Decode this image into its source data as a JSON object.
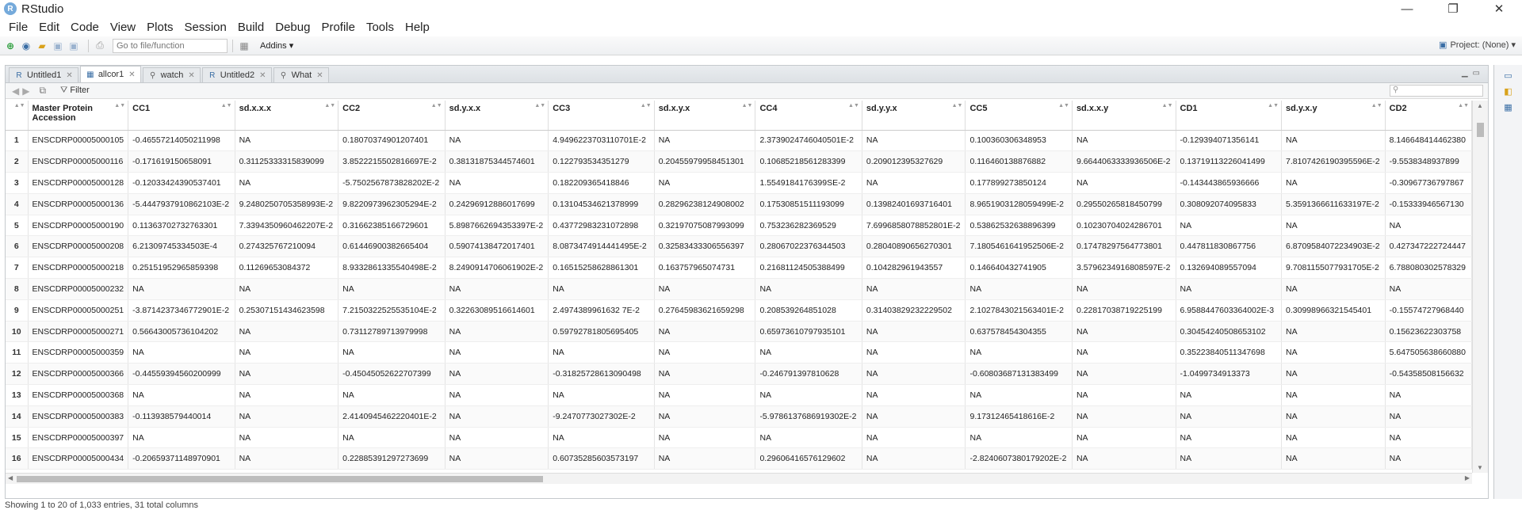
{
  "window": {
    "title": "RStudio",
    "logo_letter": "R",
    "minimize": "—",
    "maximize": "❐",
    "close": "✕"
  },
  "menu": [
    "File",
    "Edit",
    "Code",
    "View",
    "Plots",
    "Session",
    "Build",
    "Debug",
    "Profile",
    "Tools",
    "Help"
  ],
  "toolbar": {
    "goto_placeholder": "Go to file/function",
    "addins_label": "Addins ▾",
    "project_label": "Project: (None) ▾"
  },
  "tabs": [
    {
      "label": "Untitled1",
      "icon": "R"
    },
    {
      "label": "allcor1",
      "icon": "▦"
    },
    {
      "label": "watch",
      "icon": "🔍"
    },
    {
      "label": "Untitled2",
      "icon": "R"
    },
    {
      "label": "What",
      "icon": "🔍"
    }
  ],
  "filter_label": "Filter",
  "table": {
    "columns": [
      "",
      "Master Protein Accession",
      "CC1",
      "sd.x.x.x",
      "CC2",
      "sd.y.x.x",
      "CC3",
      "sd.x.y.x",
      "CC4",
      "sd.y.y.x",
      "CC5",
      "sd.x.x.y",
      "CD1",
      "sd.y.x.y",
      "CD2"
    ],
    "rows": [
      [
        "1",
        "ENSCDRP00005000105",
        "-0.46557214050211998",
        "NA",
        "0.18070374901207401",
        "NA",
        "4.9496223703110701E-2",
        "NA",
        "2.3739024746040501E-2",
        "NA",
        "0.100360306348953",
        "NA",
        "-0.129394071356141",
        "NA",
        "8.146648414462380"
      ],
      [
        "2",
        "ENSCDRP00005000116",
        "-0.171619150658091",
        "0.31125333315839099",
        "3.8522215502816697E-2",
        "0.38131875344574601",
        "0.122793534351279",
        "0.20455979958451301",
        "0.10685218561283399",
        "0.209012395327629",
        "0.116460138876882",
        "9.6644063333936506E-2",
        "0.13719113226041499",
        "7.8107426190395596E-2",
        "-9.5538348937899"
      ],
      [
        "3",
        "ENSCDRP00005000128",
        "-0.12033424390537401",
        "NA",
        "-5.7502567873828202E-2",
        "NA",
        "0.182209365418846",
        "NA",
        "1.5549184176399SE-2",
        "NA",
        "0.177899273850124",
        "NA",
        "-0.143443865936666",
        "NA",
        "-0.30967736797867"
      ],
      [
        "4",
        "ENSCDRP00005000136",
        "-5.4447937910862103E-2",
        "9.2480250705358993E-2",
        "9.8220973962305294E-2",
        "0.24296912886017699",
        "0.13104534621378999",
        "0.28296238124908002",
        "0.17530851511193099",
        "0.13982401693716401",
        "8.9651903128059499E-2",
        "0.29550265818450799",
        "0.308092074095833",
        "5.3591366611633197E-2",
        "-0.15333946567130"
      ],
      [
        "5",
        "ENSCDRP00005000190",
        "0.11363702732763301",
        "7.3394350960462207E-2",
        "0.31662385166729601",
        "5.8987662694353397E-2",
        "0.43772983231072898",
        "0.32197075087993099",
        "0.753236282369529",
        "7.6996858078852801E-2",
        "0.53862532638896399",
        "0.10230704024286701",
        "NA",
        "NA",
        "NA"
      ],
      [
        "6",
        "ENSCDRP00005000208",
        "6.21309745334503E-4",
        "0.274325767210094",
        "0.61446900382665404",
        "0.59074138472017401",
        "8.0873474914441495E-2",
        "0.32583433306556397",
        "0.28067022376344503",
        "0.28040890656270301",
        "7.1805461641952506E-2",
        "0.17478297564773801",
        "0.447811830867756",
        "6.8709584072234903E-2",
        "0.427347222724447"
      ],
      [
        "7",
        "ENSCDRP00005000218",
        "0.25151952965859398",
        "0.11269653084372",
        "8.9332861335540498E-2",
        "8.2490914706061902E-2",
        "0.16515258628861301",
        "0.163757965074731",
        "0.21681124505388499",
        "0.104282961943557",
        "0.146640432741905",
        "3.5796234916808597E-2",
        "0.132694089557094",
        "9.7081155077931705E-2",
        "6.788080302578329"
      ],
      [
        "8",
        "ENSCDRP00005000232",
        "NA",
        "NA",
        "NA",
        "NA",
        "NA",
        "NA",
        "NA",
        "NA",
        "NA",
        "NA",
        "NA",
        "NA",
        "NA"
      ],
      [
        "9",
        "ENSCDRP00005000251",
        "-3.8714237346772901E-2",
        "0.25307151434623598",
        "7.2150322525535104E-2",
        "0.32263089516614601",
        "2.4974389961632 7E-2",
        "0.27645983621659298",
        "0.208539264851028",
        "0.31403829232229502",
        "2.1027843021563401E-2",
        "0.22817038719225199",
        "6.9588447603364002E-3",
        "0.30998966321545401",
        "-0.15574727968440"
      ],
      [
        "10",
        "ENSCDRP00005000271",
        "0.56643005736104202",
        "NA",
        "0.73112789713979998",
        "NA",
        "0.59792781805695405",
        "NA",
        "0.65973610797935101",
        "NA",
        "0.637578454304355",
        "NA",
        "0.30454240508653102",
        "NA",
        "0.15623622303758"
      ],
      [
        "11",
        "ENSCDRP00005000359",
        "NA",
        "NA",
        "NA",
        "NA",
        "NA",
        "NA",
        "NA",
        "NA",
        "NA",
        "NA",
        "0.35223840511347698",
        "NA",
        "5.647505638660880"
      ],
      [
        "12",
        "ENSCDRP00005000366",
        "-0.44559394560200999",
        "NA",
        "-0.45045052622707399",
        "NA",
        "-0.31825728613090498",
        "NA",
        "-0.246791397810628",
        "NA",
        "-0.60803687131383499",
        "NA",
        "-1.0499734913373",
        "NA",
        "-0.54358508156632"
      ],
      [
        "13",
        "ENSCDRP00005000368",
        "NA",
        "NA",
        "NA",
        "NA",
        "NA",
        "NA",
        "NA",
        "NA",
        "NA",
        "NA",
        "NA",
        "NA",
        "NA"
      ],
      [
        "14",
        "ENSCDRP00005000383",
        "-0.113938579440014",
        "NA",
        "2.4140945462220401E-2",
        "NA",
        "-9.2470773027302E-2",
        "NA",
        "-5.9786137686919302E-2",
        "NA",
        "9.17312465418616E-2",
        "NA",
        "NA",
        "NA",
        "NA"
      ],
      [
        "15",
        "ENSCDRP00005000397",
        "NA",
        "NA",
        "NA",
        "NA",
        "NA",
        "NA",
        "NA",
        "NA",
        "NA",
        "NA",
        "NA",
        "NA",
        "NA"
      ],
      [
        "16",
        "ENSCDRP00005000434",
        "-0.20659371148970901",
        "NA",
        "0.22885391297273699",
        "NA",
        "0.60735285603573197",
        "NA",
        "0.29606416576129602",
        "NA",
        "-2.8240607380179202E-2",
        "NA",
        "NA",
        "NA",
        "NA"
      ]
    ]
  },
  "status": "Showing 1 to 20 of 1,033 entries, 31 total columns"
}
